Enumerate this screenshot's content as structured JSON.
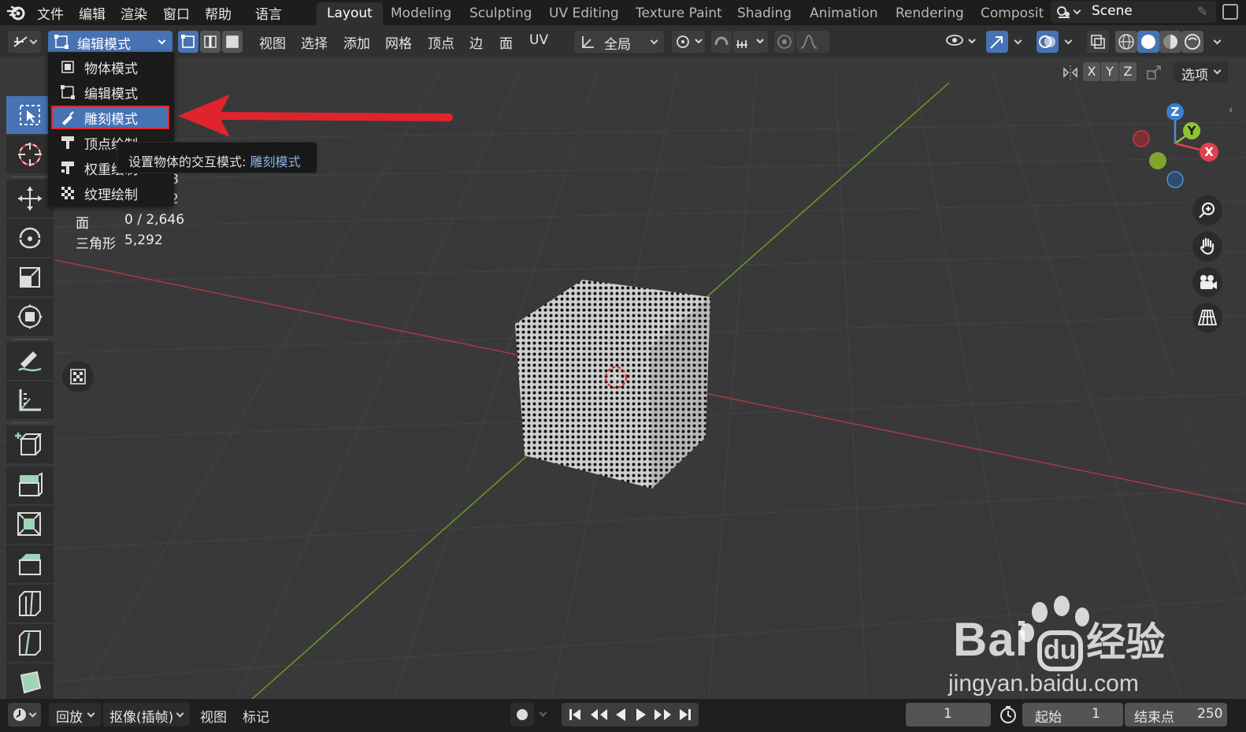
{
  "app": {
    "name": "Blender"
  },
  "menu": [
    "文件",
    "编辑",
    "渲染",
    "窗口",
    "帮助",
    "语言"
  ],
  "workspaces": [
    {
      "label": "Layout",
      "active": true
    },
    {
      "label": "Modeling"
    },
    {
      "label": "Sculpting"
    },
    {
      "label": "UV Editing"
    },
    {
      "label": "Texture Paint"
    },
    {
      "label": "Shading"
    },
    {
      "label": "Animation"
    },
    {
      "label": "Rendering"
    },
    {
      "label": "Composit"
    }
  ],
  "scene": {
    "label": "Scene"
  },
  "header": {
    "mode_label": "编辑模式",
    "menus": [
      "视图",
      "选择",
      "添加",
      "网格",
      "顶点",
      "边",
      "面",
      "UV"
    ],
    "transform_orientation": "全局",
    "options_label": "选项",
    "axes": [
      "X",
      "Y",
      "Z"
    ]
  },
  "mode_dropdown": {
    "items": [
      {
        "label": "物体模式",
        "icon": "object-mode-icon"
      },
      {
        "label": "编辑模式",
        "icon": "edit-mode-icon"
      },
      {
        "label": "雕刻模式",
        "icon": "sculpt-mode-icon",
        "selected": true
      },
      {
        "label": "顶点绘制",
        "icon": "vertex-paint-icon"
      },
      {
        "label": "权重绘制",
        "icon": "weight-paint-icon"
      },
      {
        "label": "纹理绘制",
        "icon": "texture-paint-icon"
      }
    ]
  },
  "tooltip": {
    "prefix": "设置物体的交互模式:",
    "value": "雕刻模式"
  },
  "stats": {
    "row1_value": "8",
    "row2_value": "2",
    "faces_label": "面",
    "faces_value": "0 / 2,646",
    "tris_label": "三角形",
    "tris_value": "5,292"
  },
  "gizmo": {
    "z": "Z",
    "y": "Y",
    "x": "X"
  },
  "timeline": {
    "playback": "回放",
    "keying": "抠像(插帧)",
    "view": "视图",
    "marker": "标记",
    "current_frame": "1",
    "start_label": "起始",
    "start_value": "1",
    "end_label": "结束点",
    "end_value": "250"
  },
  "watermark": {
    "line1": "Bai",
    "line1b": "经验",
    "line2": "jingyan.baidu.com"
  },
  "colors": {
    "accent": "#4772b3",
    "highlight": "#e0242c",
    "x_axis": "#c43c47",
    "y_axis": "#6b9a2a"
  }
}
